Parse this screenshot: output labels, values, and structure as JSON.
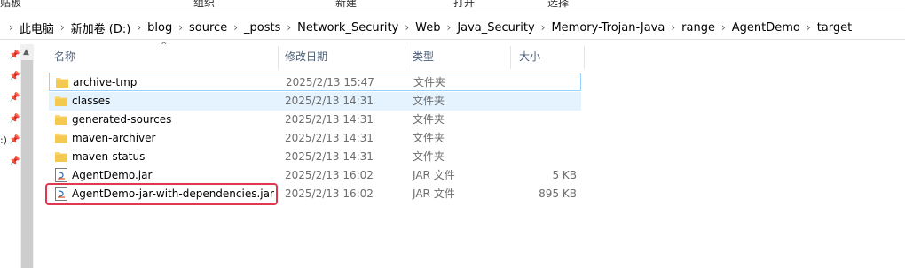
{
  "ribbon": {
    "clipboard": "贴板",
    "organize": "组织",
    "new": "新建",
    "open": "打开",
    "select": "选择"
  },
  "breadcrumb": [
    "此电脑",
    "新加卷 (D:)",
    "blog",
    "source",
    "_posts",
    "Network_Security",
    "Web",
    "Java_Security",
    "Memory-Trojan-Java",
    "range",
    "AgentDemo",
    "target"
  ],
  "columns": {
    "name": "名称",
    "date": "修改日期",
    "type": "类型",
    "size": "大小"
  },
  "files": [
    {
      "name": "archive-tmp",
      "date": "2025/2/13 15:47",
      "type": "文件夹",
      "size": "",
      "icon": "folder-icon"
    },
    {
      "name": "classes",
      "date": "2025/2/13 14:31",
      "type": "文件夹",
      "size": "",
      "icon": "folder-icon"
    },
    {
      "name": "generated-sources",
      "date": "2025/2/13 14:31",
      "type": "文件夹",
      "size": "",
      "icon": "folder-icon"
    },
    {
      "name": "maven-archiver",
      "date": "2025/2/13 14:31",
      "type": "文件夹",
      "size": "",
      "icon": "folder-icon"
    },
    {
      "name": "maven-status",
      "date": "2025/2/13 14:31",
      "type": "文件夹",
      "size": "",
      "icon": "folder-icon"
    },
    {
      "name": "AgentDemo.jar",
      "date": "2025/2/13 16:02",
      "type": "JAR 文件",
      "size": "5 KB",
      "icon": "jar-file-icon"
    },
    {
      "name": "AgentDemo-jar-with-dependencies.jar",
      "date": "2025/2/13 16:02",
      "type": "JAR 文件",
      "size": "895 KB",
      "icon": "jar-file-icon"
    }
  ],
  "sidebar": {
    "edge_text": ":)"
  },
  "colors": {
    "highlight": "#e0384d",
    "folder": "#f8d775",
    "hover": "#e5f3ff"
  }
}
